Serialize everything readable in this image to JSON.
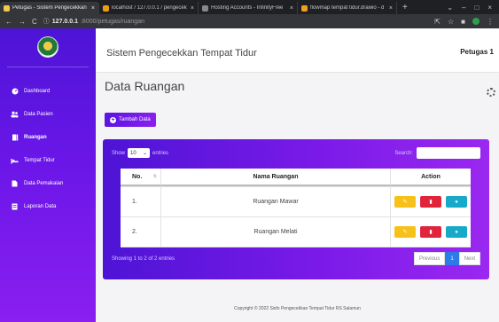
{
  "browser": {
    "tabs": [
      {
        "title": "Petugas - Sistem Pengecekkan Te",
        "color": "#f2c94c",
        "active": true
      },
      {
        "title": "localhost / 127.0.0.1 / pengecek",
        "color": "#f09a1a",
        "active": false
      },
      {
        "title": "Hosting Accounts - InfinityFree",
        "color": "#888888",
        "active": false
      },
      {
        "title": "flowmap tempat tidur.drawio - d",
        "color": "#f0a020",
        "active": false
      }
    ],
    "new_tab": "+",
    "url_host": "127.0.0.1",
    "url_path": ":8000/petugas/ruangan"
  },
  "sidebar": {
    "items": [
      {
        "label": "Dashboard",
        "icon": "dashboard-icon"
      },
      {
        "label": "Data Pasien",
        "icon": "users-icon"
      },
      {
        "label": "Ruangan",
        "icon": "room-icon"
      },
      {
        "label": "Tempat Tidur",
        "icon": "bed-icon"
      },
      {
        "label": "Data Pemakaian",
        "icon": "file-icon"
      },
      {
        "label": "Laporan Data",
        "icon": "report-icon"
      }
    ]
  },
  "header": {
    "title": "Sistem Pengecekkan Tempat Tidur",
    "user": "Petugas 1"
  },
  "main": {
    "page_title": "Data Ruangan",
    "add_button": "Tambah Data",
    "show_label": "Show",
    "entries_value": "10",
    "entries_label": "entries",
    "search_label": "Search:",
    "columns": [
      "No.",
      "Nama Ruangan",
      "Action"
    ],
    "rows": [
      {
        "no": "1.",
        "name": "Ruangan Mawar"
      },
      {
        "no": "2.",
        "name": "Ruangan Melati"
      }
    ],
    "info": "Showing 1 to 2 of 2 entries",
    "pager": {
      "previous": "Previous",
      "current": "1",
      "next": "Next"
    },
    "footer": "Copyright © 2022 Sisfo Pengecekkan Tempat Tidur RS Salamun"
  },
  "colors": {
    "brand": "#6a16e8",
    "edit": "#f7c11a",
    "delete": "#e0243b",
    "view": "#17a9c9",
    "page_active": "#2b7be8"
  }
}
